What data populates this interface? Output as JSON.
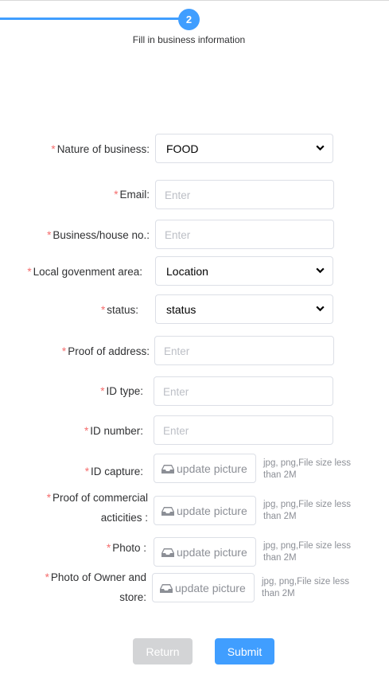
{
  "step": {
    "number": "2",
    "title": "Fill in business information"
  },
  "form": {
    "nature_label": "Nature of business:",
    "nature_value": "FOOD",
    "email_label": "Email:",
    "email_placeholder": "Enter",
    "house_label": "Business/house no.:",
    "house_placeholder": "Enter",
    "lga_label": "Local govenment area:",
    "lga_value": "Location",
    "status_label": "status:",
    "status_value": "status",
    "address_label": "Proof of address:",
    "address_placeholder": "Enter",
    "idtype_label": "ID type:",
    "idtype_placeholder": "Enter",
    "idnumber_label": "ID number:",
    "idnumber_placeholder": "Enter",
    "idcapture_label": "ID capture:",
    "commercial_label_1": "Proof of commercial",
    "commercial_label_2": "acticities :",
    "photo_label": "Photo :",
    "owner_label_1": "Photo of Owner and",
    "owner_label_2": "store:",
    "required_mark": "*",
    "upload_label": "update picture",
    "hint_line1": "jpg,  png,File size less",
    "hint_line2": "than 2M"
  },
  "buttons": {
    "return": "Return",
    "submit": "Submit"
  },
  "colors": {
    "primary": "#409eff",
    "required": "#f56c6c",
    "disabled": "#d3d4d6"
  },
  "icons": {
    "select_arrow": "chevron-down-icon",
    "upload": "inbox-tray-icon"
  }
}
